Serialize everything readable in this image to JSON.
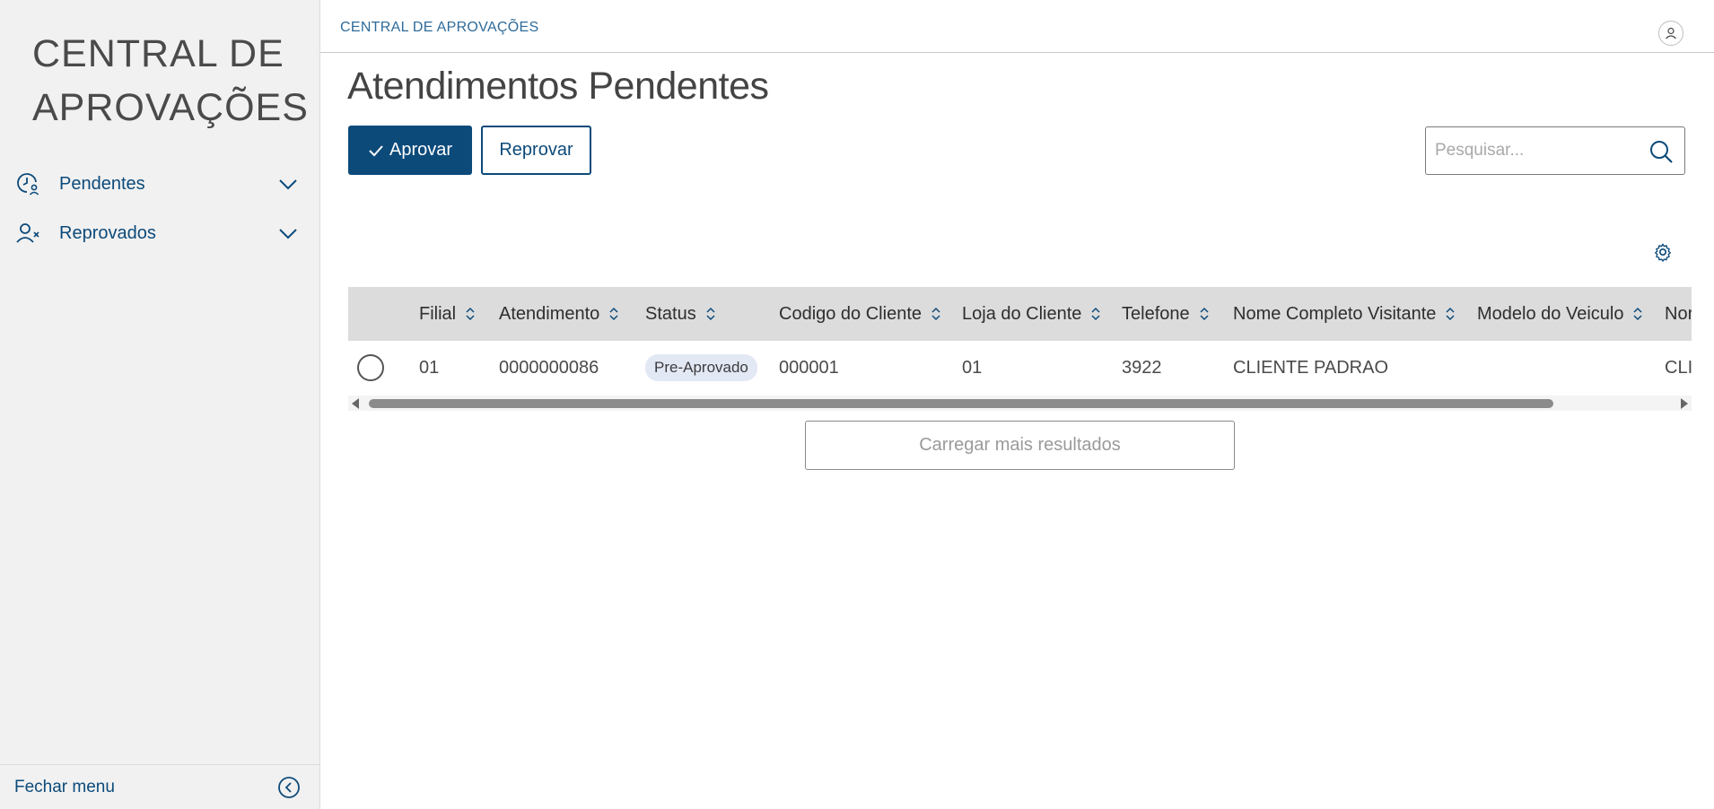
{
  "sidebar": {
    "logo_line1": "CENTRAL DE",
    "logo_line2": "APROVAÇÕES",
    "items": [
      {
        "label": "Pendentes",
        "icon": "clock-user-icon"
      },
      {
        "label": "Reprovados",
        "icon": "user-x-icon"
      }
    ],
    "footer_label": "Fechar menu"
  },
  "topbar": {
    "breadcrumb": "CENTRAL DE APROVAÇÕES",
    "avatar_icon": "user-icon"
  },
  "page": {
    "title": "Atendimentos Pendentes"
  },
  "actions": {
    "approve_label": "Aprovar",
    "reject_label": "Reprovar"
  },
  "search": {
    "placeholder": "Pesquisar...",
    "value": ""
  },
  "table": {
    "columns": [
      "Filial",
      "Atendimento",
      "Status",
      "Codigo do Cliente",
      "Loja do Cliente",
      "Telefone",
      "Nome Completo Visitante",
      "Modelo do Veiculo",
      "Nor"
    ],
    "rows": [
      {
        "filial": "01",
        "atendimento": "0000000086",
        "status": "Pre-Aprovado",
        "codigo_cliente": "000001",
        "loja_cliente": "01",
        "telefone": "3922",
        "nome_visitante": "CLIENTE PADRAO",
        "modelo_veiculo": "",
        "nome_cliente": "CLI"
      }
    ]
  },
  "load_more_label": "Carregar mais resultados",
  "colors": {
    "primary": "#0c4a7a",
    "sidebar_bg": "#f1f1f1",
    "header_bg": "#dcdcdc",
    "badge_bg": "#e3e8f5"
  }
}
